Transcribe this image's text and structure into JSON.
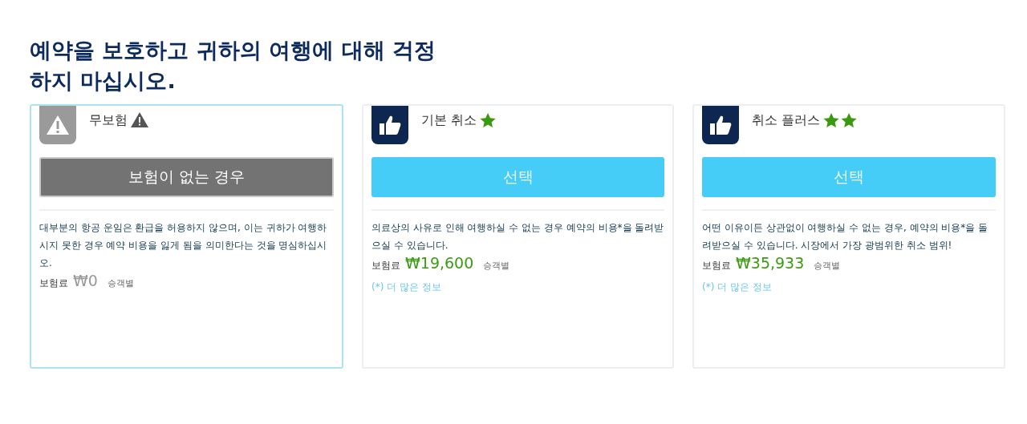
{
  "heading": [
    "예약을 보호하고 귀하의 여행에 대해 걱정",
    "하지 마십시오."
  ],
  "plans": [
    {
      "kind": "none",
      "selected": true,
      "title": "무보험",
      "button": "보험이 없는 경우",
      "description": "대부분의 항공 운임은 환급을 허용하지 않으며, 이는 귀하가 여행하시지 못한 경우 예약 비용을 잃게 됨을 의미한다는 것을 명심하십시오.",
      "premium_label": "보험료",
      "price": "₩0",
      "per": "승객별"
    },
    {
      "kind": "cancel",
      "selected": false,
      "title": "기본 취소",
      "title_icons": [
        {
          "kind": "star"
        }
      ],
      "button": "선택",
      "description": "의료상의 사유로 인해 여행하실 수 없는 경우 예약의 비용*을 돌려받으실 수 있습니다.",
      "premium_label": "보험료",
      "price": "₩19,600",
      "per": "승객별",
      "more": "(*) 더 많은 정보"
    },
    {
      "kind": "cancel",
      "selected": false,
      "title": "취소 플러스",
      "title_icons": [
        {
          "kind": "star"
        },
        {
          "kind": "star"
        }
      ],
      "button": "선택",
      "description": "어떤 이유이든 상관없이 여행하실 수 없는 경우, 예약의 비용*을 돌려받으실 수 있습니다. 시장에서 가장 광범위한 취소 범위!",
      "premium_label": "보험료",
      "price": "₩35,933",
      "per": "승객별",
      "more": "(*) 더 많은 정보"
    }
  ]
}
